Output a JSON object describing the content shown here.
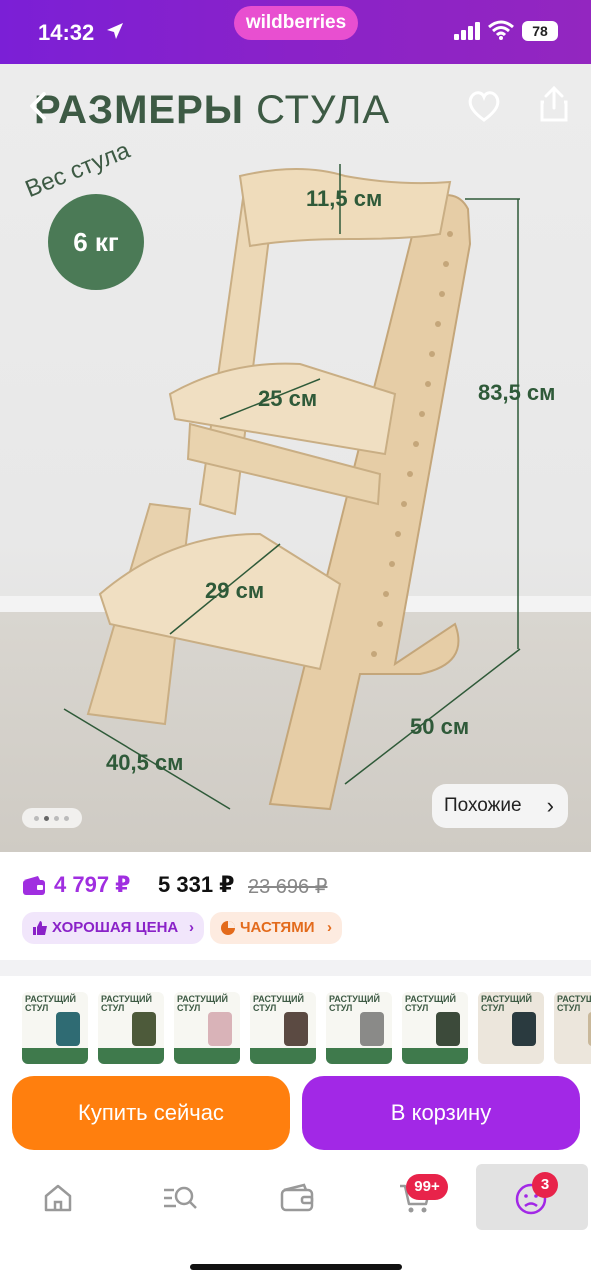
{
  "status_bar": {
    "time": "14:32",
    "brand": "wildberries",
    "battery": "78"
  },
  "product_image": {
    "title_bold": "РАЗМЕРЫ",
    "title_rest": " СТУЛА",
    "weight_label": "Вес стула",
    "weight_value": "6 кг",
    "dimensions": {
      "back_height": "11,5 см",
      "top_seat_depth": "25 см",
      "total_height": "83,5 см",
      "foot_depth": "29 см",
      "depth": "50 см",
      "width": "40,5 см"
    },
    "similar_label": "Похожие",
    "similar_chevron": "›"
  },
  "price": {
    "wallet_price": "4 797 ₽",
    "price": "5 331 ₽",
    "old_price": "23 696 ₽"
  },
  "chips": {
    "good_price": "ХОРОШАЯ ЦЕНА",
    "installments": "ЧАСТЯМИ",
    "chevron": "›"
  },
  "thumbnails": [
    {
      "title": "РАСТУЩИЙ СТУЛ",
      "seat_color": "#2f6b73"
    },
    {
      "title": "РАСТУЩИЙ СТУЛ",
      "seat_color": "#4d5a3a"
    },
    {
      "title": "РАСТУЩИЙ СТУЛ",
      "seat_color": "#d9b3b8"
    },
    {
      "title": "РАСТУЩИЙ СТУЛ",
      "seat_color": "#5b4a42"
    },
    {
      "title": "РАСТУЩИЙ СТУЛ",
      "seat_color": "#8a8a88"
    },
    {
      "title": "РАСТУЩИЙ СТУЛ",
      "seat_color": "#3c4a3a"
    },
    {
      "title": "РАСТУЩИЙ СТУЛ",
      "seat_color": "#2a3a3f"
    },
    {
      "title": "РАСТУЩИЙ СТУЛ",
      "seat_color": "#c9b89a"
    }
  ],
  "actions": {
    "buy_now": "Купить сейчас",
    "add_to_cart": "В корзину"
  },
  "bottom_nav": {
    "items": [
      "home-icon",
      "catalog-search-icon",
      "wallet-icon",
      "cart-icon",
      "profile-icon"
    ],
    "cart_badge": "99+",
    "profile_badge": "3"
  },
  "colors": {
    "brand": "#a228e6",
    "buy": "#ff7f0e",
    "dimension_text": "#2f5a39"
  }
}
